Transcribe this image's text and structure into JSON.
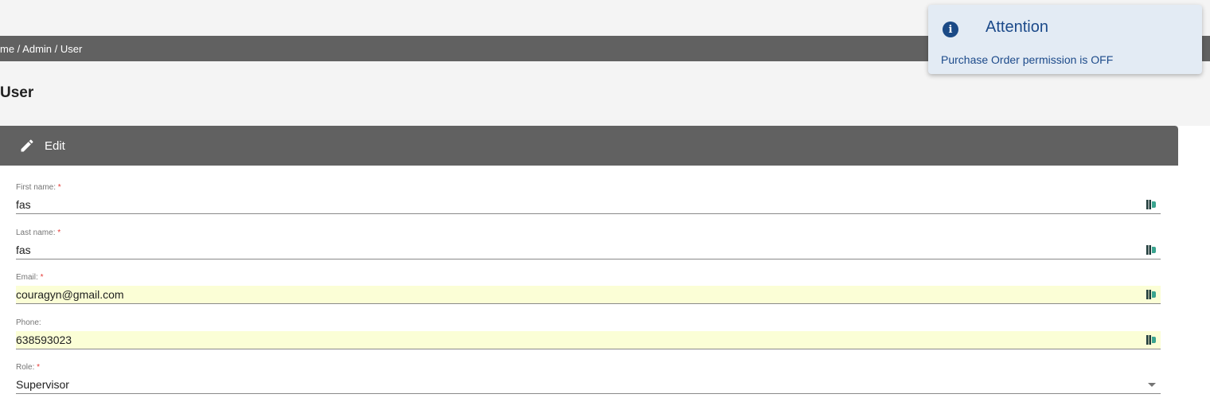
{
  "breadcrumb": "me / Admin / User",
  "page_title": "User",
  "card": {
    "header_label": "Edit",
    "header_icon": "pencil-icon"
  },
  "form": {
    "first_name": {
      "label": "First name:",
      "required_mark": "*",
      "value": "fas"
    },
    "last_name": {
      "label": "Last name:",
      "required_mark": "*",
      "value": "fas"
    },
    "email": {
      "label": "Email:",
      "required_mark": "*",
      "value": "couragyn@gmail.com"
    },
    "phone": {
      "label": "Phone:",
      "value": "638593023"
    },
    "role": {
      "label": "Role:",
      "required_mark": "*",
      "value": "Supervisor"
    }
  },
  "toast": {
    "icon": "info-icon",
    "title": "Attention",
    "message": "Purchase Order permission is OFF"
  },
  "colors": {
    "header_bg": "#616161",
    "autofill_bg": "#fbfed6",
    "toast_bg": "#e3ebf4",
    "toast_text": "#1c4a8a",
    "required": "#e53935"
  }
}
